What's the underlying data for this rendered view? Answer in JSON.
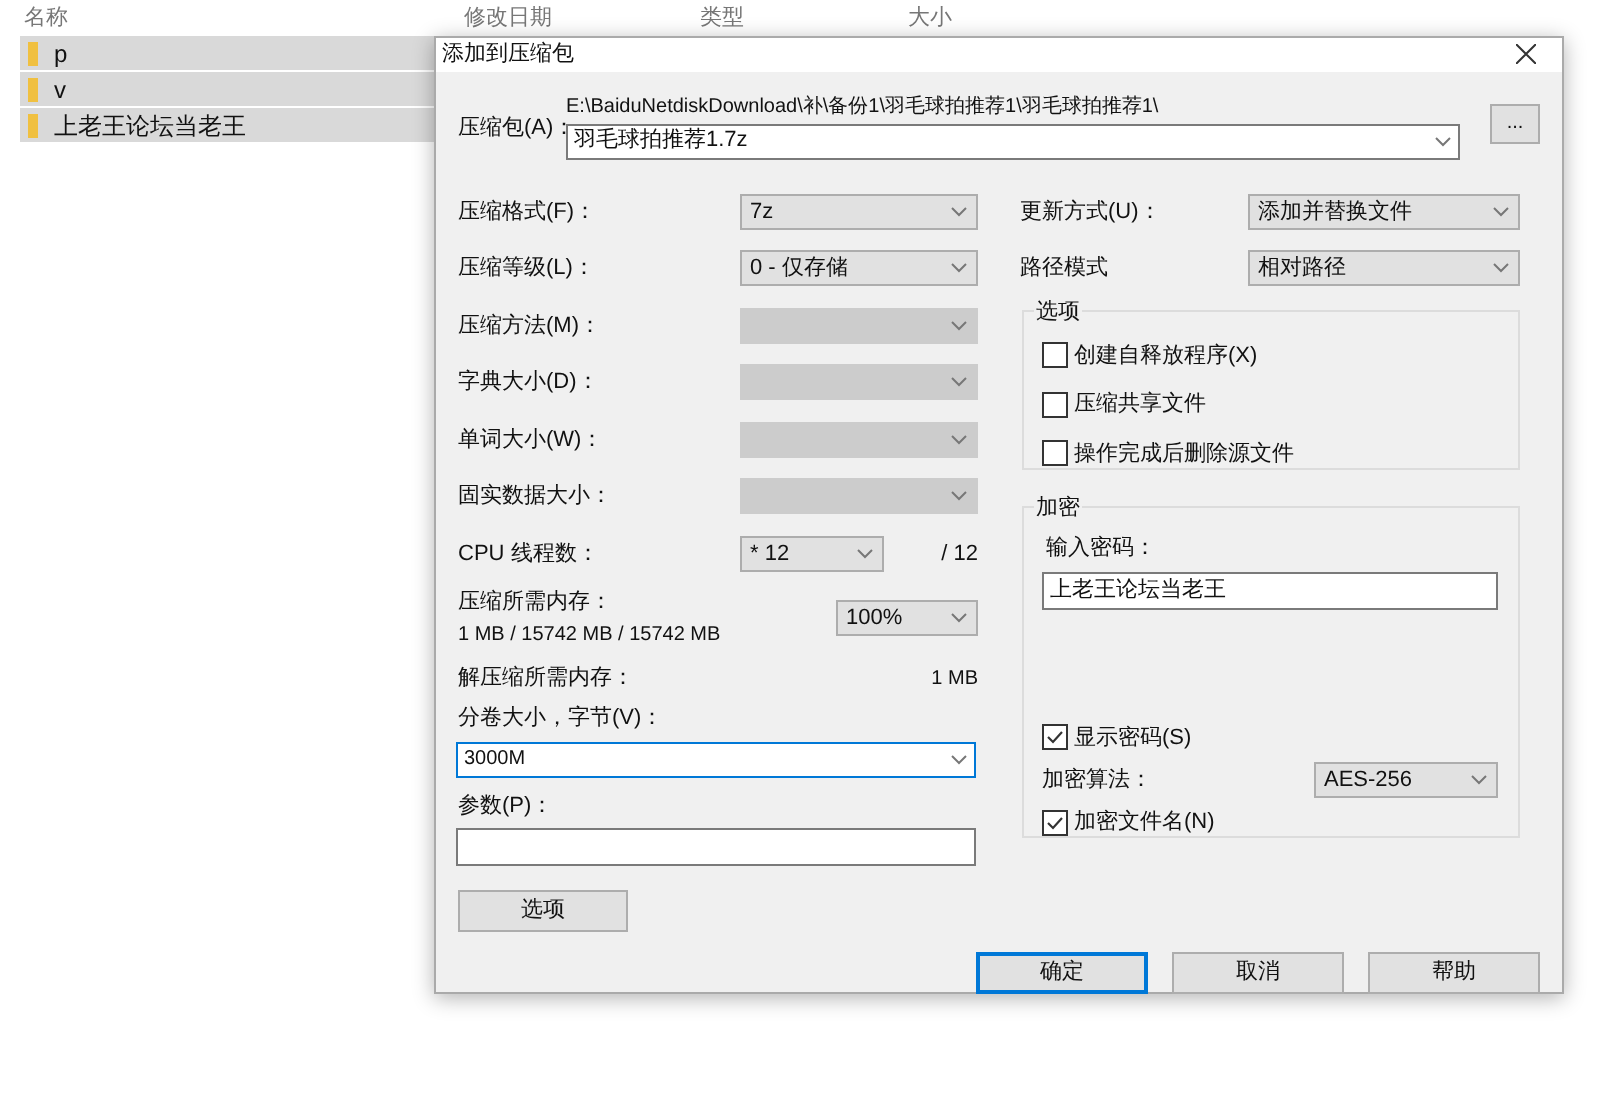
{
  "explorer": {
    "columns": [
      "名称",
      "修改日期",
      "类型",
      "大小"
    ],
    "rows": [
      {
        "name": "p",
        "selected": true
      },
      {
        "name": "v",
        "selected": true
      },
      {
        "name": "上老王论坛当老王",
        "selected": true
      }
    ]
  },
  "dialog": {
    "title": "添加到压缩包",
    "archive": {
      "label": "压缩包(A)：",
      "path": "E:\\BaiduNetdiskDownload\\补\\备份1\\羽毛球拍推荐1\\羽毛球拍推荐1\\",
      "value": "羽毛球拍推荐1.7z",
      "browse": "..."
    },
    "left_fields": [
      {
        "kind": "select",
        "label": "压缩格式(F)：",
        "value": "7z",
        "disabled": false
      },
      {
        "kind": "select",
        "label": "压缩等级(L)：",
        "value": "0 - 仅存储",
        "disabled": false
      },
      {
        "kind": "select",
        "label": "压缩方法(M)：",
        "disabled": true
      },
      {
        "kind": "select",
        "label": "字典大小(D)：",
        "disabled": true
      },
      {
        "kind": "select",
        "label": "单词大小(W)：",
        "disabled": true
      },
      {
        "kind": "select",
        "label": "固实数据大小：",
        "disabled": true
      },
      {
        "kind": "cpu",
        "label": "CPU 线程数：",
        "value": "* 12",
        "total": "/ 12"
      },
      {
        "kind": "memory",
        "label": "压缩所需内存：",
        "detail": "1 MB / 15742 MB / 15742 MB",
        "value": "100%"
      },
      {
        "kind": "info",
        "label": "解压缩所需内存：",
        "value": "1 MB"
      }
    ],
    "volume": {
      "label": "分卷大小，字节(V)：",
      "value": "3000M"
    },
    "params": {
      "label": "参数(P)："
    },
    "options_button": "选项",
    "update": {
      "label": "更新方式(U)：",
      "value": "添加并替换文件"
    },
    "path_mode": {
      "label": "路径模式",
      "value": "相对路径"
    },
    "options": {
      "title": "选项",
      "items": [
        {
          "label": "创建自释放程序(X)",
          "checked": false
        },
        {
          "label": "压缩共享文件",
          "checked": false
        },
        {
          "label": "操作完成后删除源文件",
          "checked": false
        }
      ]
    },
    "encryption": {
      "title": "加密",
      "password_label": "输入密码：",
      "password": "上老王论坛当老王",
      "show_password": {
        "label": "显示密码(S)",
        "checked": true
      },
      "method": {
        "label": "加密算法：",
        "value": "AES-256"
      },
      "encrypt_names": {
        "label": "加密文件名(N)",
        "checked": true
      }
    },
    "buttons": [
      {
        "label": "确定",
        "default": true
      },
      {
        "label": "取消",
        "default": false
      },
      {
        "label": "帮助",
        "default": false
      }
    ]
  }
}
